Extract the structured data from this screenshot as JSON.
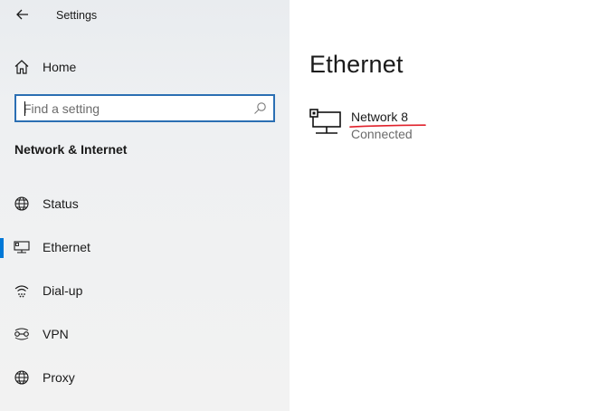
{
  "window": {
    "title": "Settings"
  },
  "sidebar": {
    "home_label": "Home",
    "search": {
      "placeholder": "Find a setting",
      "value": ""
    },
    "section_title": "Network & Internet",
    "items": [
      {
        "label": "Status",
        "icon": "globe-status-icon",
        "selected": false
      },
      {
        "label": "Ethernet",
        "icon": "ethernet-icon",
        "selected": true
      },
      {
        "label": "Dial-up",
        "icon": "dial-up-icon",
        "selected": false
      },
      {
        "label": "VPN",
        "icon": "vpn-icon",
        "selected": false
      },
      {
        "label": "Proxy",
        "icon": "globe-icon",
        "selected": false
      }
    ]
  },
  "main": {
    "title": "Ethernet",
    "network": {
      "name": "Network 8",
      "status": "Connected",
      "icon": "ethernet-network-icon"
    }
  },
  "colors": {
    "accent": "#0078d7",
    "search_border": "#2b6fb3",
    "annotation_underline": "#e0202a",
    "secondary_text": "#6b6b6b"
  }
}
